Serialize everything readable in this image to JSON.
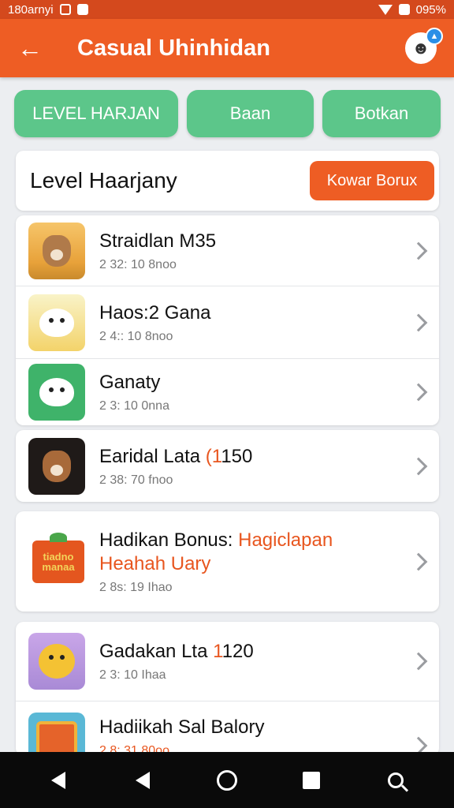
{
  "status_bar": {
    "left_text": "180arnyi",
    "battery_text": "095%"
  },
  "app_bar": {
    "title": "Casual Uhinhidan",
    "back_icon": "arrow-left-icon",
    "avatar_icon": "mascot-avatar-icon"
  },
  "filters": [
    {
      "label": "LEVEL HARJAN"
    },
    {
      "label": "Baan"
    },
    {
      "label": "Botkan"
    }
  ],
  "header_card": {
    "title": "Level Haarjany",
    "button_label": "Kowar Borux"
  },
  "list_group_1": [
    {
      "title": "Straidlan M35",
      "meta": "2 32: 10 8noo"
    },
    {
      "title": "Haos:2 Gana",
      "meta": "2 4:: 10 8noo"
    },
    {
      "title": "Ganaty",
      "meta": "2 3: 10 0nna"
    }
  ],
  "list_group_2": [
    {
      "title_main": "Earidal Lata ",
      "title_accent": "(1",
      "title_tail": "150",
      "meta": "2 38: 70 fnoo"
    }
  ],
  "list_group_3": [
    {
      "title_main": "Hadikan Bonus: ",
      "title_accent": "Hagiclapan",
      "subtitle": "Heahah Uary",
      "meta": "2 8s: 19 Ihao",
      "thumb_text": "tiadno manaa"
    }
  ],
  "list_group_4": [
    {
      "title_main": "Gadakan Lta ",
      "title_accent": "1",
      "title_tail": "120",
      "meta": "2 3: 10 Ihaa"
    },
    {
      "title": "Hadiikah Sal Balory",
      "meta": "2 8: 31 80oo"
    }
  ],
  "colors": {
    "status_bar": "#d4491d",
    "app_bar": "#ee5d24",
    "pill": "#5cc68a",
    "accent": "#e8561f"
  }
}
